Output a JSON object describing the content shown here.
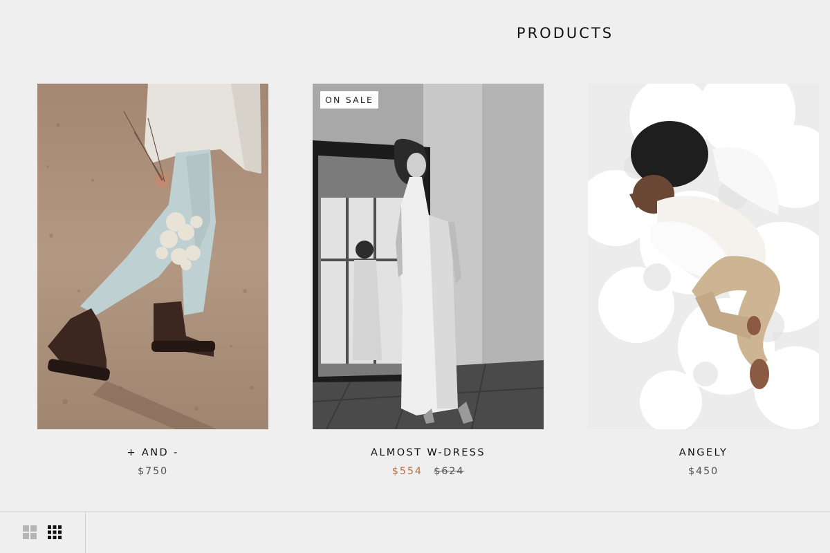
{
  "page": {
    "title": "PRODUCTS"
  },
  "products": [
    {
      "name": "+ AND -",
      "price": "$750",
      "photo": "woman in jeans and boots walking on sand holding dried flowers"
    },
    {
      "name": "ALMOST W-DRESS",
      "badge": "ON SALE",
      "sale_price": "$554",
      "old_price": "$624",
      "photo": "woman in white wrap dress standing by a mirror"
    },
    {
      "name": "ANGELY",
      "price": "$450",
      "photo": "child with angel wings lying on cotton clouds"
    }
  ],
  "layout_switch": {
    "options": [
      "grid-2x2-icon",
      "grid-3x3-icon"
    ],
    "selected": "grid-3x3-icon"
  },
  "colors": {
    "background": "#efefef",
    "sale_price": "#c0703f",
    "text": "#111111"
  }
}
